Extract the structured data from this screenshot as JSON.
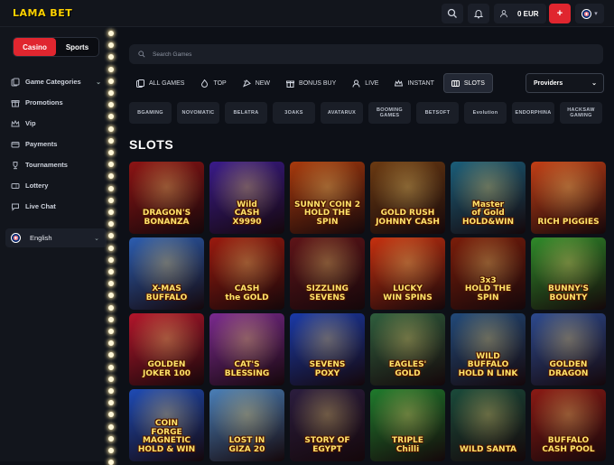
{
  "brand": {
    "logo": "LAMA BET",
    "accent": "#e0262f",
    "logo_color": "#ffd200"
  },
  "topbar": {
    "search_icon": "search-icon",
    "notifications_icon": "bell-icon",
    "user_icon": "user-icon",
    "balance": "0 EUR",
    "deposit_label": "+",
    "language_flag": "uk-flag-icon"
  },
  "sidebar": {
    "toggle": {
      "casino": "Casino",
      "sports": "Sports"
    },
    "items": [
      {
        "label": "Game Categories",
        "icon": "game-categories-icon",
        "has_arrow": true
      },
      {
        "label": "Promotions",
        "icon": "gift-icon"
      },
      {
        "label": "Vip",
        "icon": "crown-icon"
      },
      {
        "label": "Payments",
        "icon": "card-icon"
      },
      {
        "label": "Tournaments",
        "icon": "trophy-icon"
      },
      {
        "label": "Lottery",
        "icon": "ticket-icon"
      },
      {
        "label": "Live Chat",
        "icon": "chat-icon"
      }
    ],
    "language": "English"
  },
  "main": {
    "search_placeholder": "Search Games",
    "tabs": [
      {
        "label": "ALL GAMES",
        "icon": "all-games-icon",
        "active": false
      },
      {
        "label": "TOP",
        "icon": "fire-icon",
        "active": false
      },
      {
        "label": "NEW",
        "icon": "new-icon",
        "active": false
      },
      {
        "label": "BONUS BUY",
        "icon": "bonus-buy-icon",
        "active": false
      },
      {
        "label": "LIVE",
        "icon": "live-dealer-icon",
        "active": false
      },
      {
        "label": "INSTANT",
        "icon": "instant-icon",
        "active": false
      },
      {
        "label": "SLOTS",
        "icon": "slots-icon",
        "active": true
      }
    ],
    "providers_label": "Providers",
    "providers": [
      "BGAMING",
      "NOVOMATIC",
      "BELATRA",
      "3OAKS",
      "AVATARUX",
      "BOOMING GAMES",
      "BETSOFT",
      "Evolution",
      "ENDORPHINA",
      "HACKSAW GAMING"
    ],
    "section_title": "SLOTS",
    "games": [
      {
        "title": "DRAGON'S\nBONANZA",
        "bg": "#8d1414"
      },
      {
        "title": "Wild\nCASH\nX9990",
        "bg": "#3a1b8a"
      },
      {
        "title": "SUNNY COIN 2\nHOLD THE SPIN",
        "bg": "#a83a0d"
      },
      {
        "title": "GOLD RUSH\nJOHNNY CASH",
        "bg": "#6b3a12"
      },
      {
        "title": "Master\nof Gold\nHOLD&WIN",
        "bg": "#1b5e7a"
      },
      {
        "title": "RICH PIGGIES",
        "bg": "#c23f16"
      },
      {
        "title": "X-MAS\nBUFFALO",
        "bg": "#2c5db0"
      },
      {
        "title": "CASH\nthe GOLD",
        "bg": "#9a1a0e"
      },
      {
        "title": "SIZZLING\nSEVENS",
        "bg": "#5e1418"
      },
      {
        "title": "LUCKY\nWIN SPINS",
        "bg": "#c6300f"
      },
      {
        "title": "3x3\nHOLD THE SPIN",
        "bg": "#7a1d0a"
      },
      {
        "title": "BUNNY'S\nBOUNTY",
        "bg": "#2f8a2a"
      },
      {
        "title": "GOLDEN\nJOKER 100",
        "bg": "#b3162b"
      },
      {
        "title": "CAT'S\nBLESSING",
        "bg": "#7b2a8f"
      },
      {
        "title": "SEVENS\nPOXY",
        "bg": "#1a3aa8"
      },
      {
        "title": "EAGLES'\nGOLD",
        "bg": "#2f5e3d"
      },
      {
        "title": "WILD\nBUFFALO\nHOLD N LINK",
        "bg": "#224a7a"
      },
      {
        "title": "GOLDEN\nDRAGON",
        "bg": "#2d4a8f"
      },
      {
        "title": "COIN\nFORGE\nMAGNETIC\nHOLD & WIN",
        "bg": "#1e4bb5"
      },
      {
        "title": "LOST IN\nGIZA 20",
        "bg": "#4a7fb8"
      },
      {
        "title": "STORY OF EGYPT",
        "bg": "#2b1d3e"
      },
      {
        "title": "TRIPLE\nChilli",
        "bg": "#1f7a2c"
      },
      {
        "title": "WILD SANTA",
        "bg": "#1a4a3a"
      },
      {
        "title": "BUFFALO\nCASH POOL",
        "bg": "#8a1a14"
      }
    ]
  }
}
